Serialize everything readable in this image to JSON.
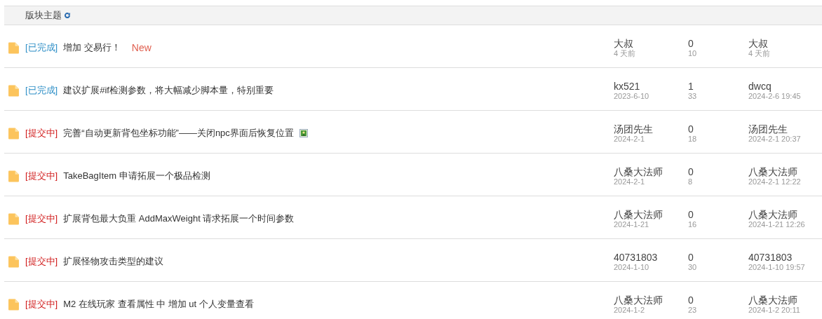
{
  "header": {
    "title": "版块主题"
  },
  "threads": [
    {
      "status": {
        "kind": "done",
        "label": "[已完成]"
      },
      "title": "增加 交易行！",
      "new_badge": "New",
      "author": "大叔",
      "created": "4 天前",
      "replies": "0",
      "views": "10",
      "last_poster": "大叔",
      "last_time": "4 天前"
    },
    {
      "status": {
        "kind": "done",
        "label": "[已完成]"
      },
      "title": "建议扩展#if检测参数，将大幅减少脚本量，特别重要",
      "author": "kx521",
      "created": "2023-6-10",
      "replies": "1",
      "views": "33",
      "last_poster": "dwcq",
      "last_time": "2024-2-6 19:45"
    },
    {
      "status": {
        "kind": "pending",
        "label": "[提交中]"
      },
      "title": "完善“自动更新背包坐标功能”——关闭npc界面后恢复位置",
      "has_image": true,
      "author": "汤团先生",
      "created": "2024-2-1",
      "replies": "0",
      "views": "18",
      "last_poster": "汤团先生",
      "last_time": "2024-2-1 20:37"
    },
    {
      "status": {
        "kind": "pending",
        "label": "[提交中]"
      },
      "title": "TakeBagItem 申请拓展一个极品检测",
      "author": "八桑大法师",
      "created": "2024-2-1",
      "replies": "0",
      "views": "8",
      "last_poster": "八桑大法师",
      "last_time": "2024-2-1 12:22"
    },
    {
      "status": {
        "kind": "pending",
        "label": "[提交中]"
      },
      "title": "扩展背包最大负重 AddMaxWeight 请求拓展一个时间参数",
      "author": "八桑大法师",
      "created": "2024-1-21",
      "replies": "0",
      "views": "16",
      "last_poster": "八桑大法师",
      "last_time": "2024-1-21 12:26"
    },
    {
      "status": {
        "kind": "pending",
        "label": "[提交中]"
      },
      "title": "扩展怪物攻击类型的建议",
      "author": "40731803",
      "created": "2024-1-10",
      "replies": "0",
      "views": "30",
      "last_poster": "40731803",
      "last_time": "2024-1-10 19:57"
    },
    {
      "status": {
        "kind": "pending",
        "label": "[提交中]"
      },
      "title": "M2 在线玩家 查看属性 中 增加 ut 个人变量查看",
      "author": "八桑大法师",
      "created": "2024-1-2",
      "replies": "0",
      "views": "23",
      "last_poster": "八桑大法师",
      "last_time": "2024-1-2 20:11"
    }
  ]
}
